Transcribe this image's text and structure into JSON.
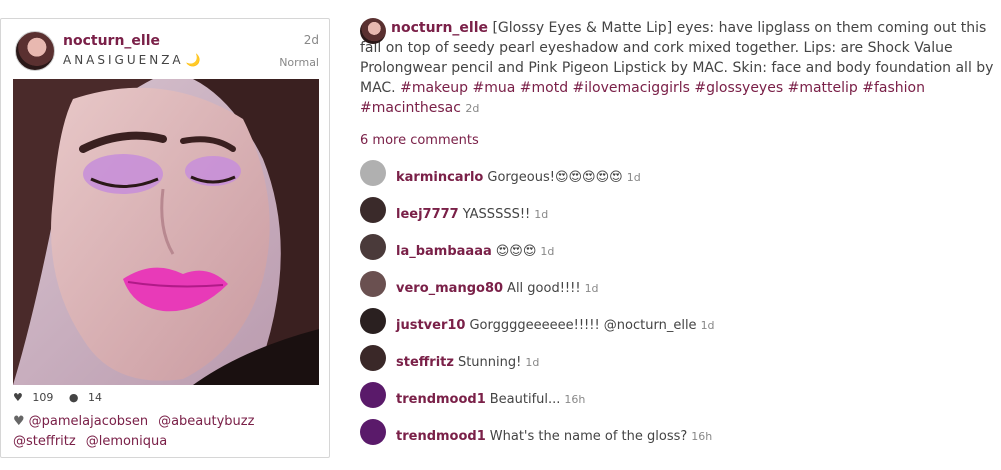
{
  "post": {
    "username": "nocturn_elle",
    "caption_short": "ANASIGUENZA",
    "caption_emoji": "🌙",
    "time": "2d",
    "filter": "Normal",
    "likes_count": "109",
    "comments_count": "14",
    "tagged": [
      "@pamelajacobsen",
      "@abeautybuzz",
      "@steffritz",
      "@lemoniqua"
    ]
  },
  "caption": {
    "username": "nocturn_elle",
    "text": "[Glossy Eyes & Matte Lip] eyes: have lipglass on them coming out this fall on top of seedy pearl eyeshadow and cork mixed together. Lips: are Shock Value Prolongwear pencil and Pink Pigeon Lipstick by MAC. Skin: face and body foundation all by MAC.",
    "hashtags": [
      "#makeup",
      "#mua",
      "#motd",
      "#ilovemaciggirls",
      "#glossyeyes",
      "#mattelip",
      "#fashion",
      "#macinthesac"
    ],
    "time": "2d"
  },
  "more_comments": "6 more comments",
  "comments": [
    {
      "user": "karmincarlo",
      "text": "Gorgeous!😍😍😍😍😍",
      "time": "1d",
      "avatar_color": "#b0b0b0"
    },
    {
      "user": "leej7777",
      "text": "YASSSSS!!",
      "time": "1d",
      "avatar_color": "#3a2a2a"
    },
    {
      "user": "la_bambaaaa",
      "text": "😍😍😍",
      "time": "1d",
      "avatar_color": "#4a3a3a"
    },
    {
      "user": "vero_mango80",
      "text": "All good!!!!",
      "time": "1d",
      "avatar_color": "#6a5050"
    },
    {
      "user": "justver10",
      "text": "Gorggggeeeeee!!!!! @nocturn_elle",
      "time": "1d",
      "avatar_color": "#2a2020"
    },
    {
      "user": "steffritz",
      "text": "Stunning!",
      "time": "1d",
      "avatar_color": "#3a2828"
    },
    {
      "user": "trendmood1",
      "text": "Beautiful...",
      "time": "16h",
      "avatar_color": "#5a1a6a"
    },
    {
      "user": "trendmood1",
      "text": "What's the name of the gloss?",
      "time": "16h",
      "avatar_color": "#5a1a6a"
    }
  ],
  "colors": {
    "accent": "#7a2048",
    "share_colors": [
      "#5aa0d8",
      "#7ab8e0",
      "#d84a3a",
      "#3b5998",
      "#dddddd"
    ]
  }
}
